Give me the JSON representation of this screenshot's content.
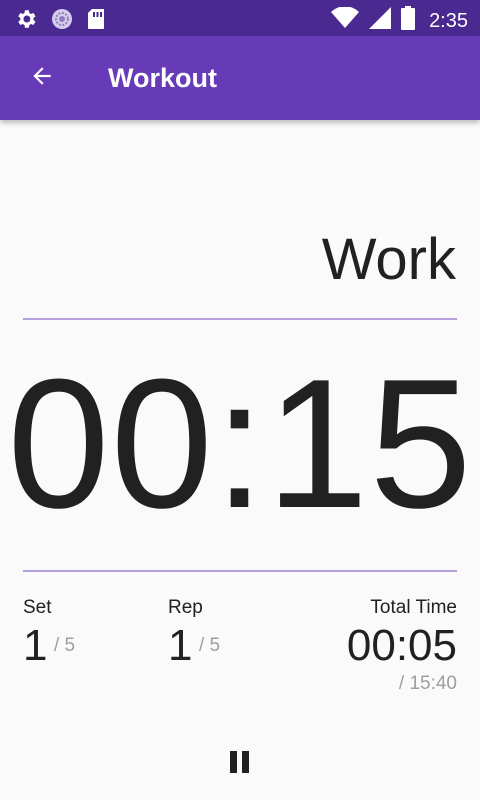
{
  "status_bar": {
    "time": "2:35",
    "icons": [
      "gear-icon",
      "sync-icon",
      "sd-card-icon",
      "wifi-icon",
      "signal-icon",
      "battery-icon"
    ],
    "background": "#4a2a91"
  },
  "app_bar": {
    "title": "Workout",
    "back_icon": "arrow-back-icon",
    "background": "#673ab7"
  },
  "phase": {
    "label": "Work"
  },
  "timer": {
    "value": "00:15"
  },
  "stats": {
    "set": {
      "label": "Set",
      "current": "1",
      "total": "/ 5"
    },
    "rep": {
      "label": "Rep",
      "current": "1",
      "total": "/ 5"
    },
    "total_time": {
      "label": "Total Time",
      "current": "00:05",
      "total": "/ 15:40"
    }
  },
  "controls": {
    "pause_icon": "pause-icon"
  },
  "colors": {
    "accent": "#673ab7",
    "divider": "#b39ddb",
    "text_primary": "#212121",
    "text_secondary": "#9e9e9e"
  }
}
